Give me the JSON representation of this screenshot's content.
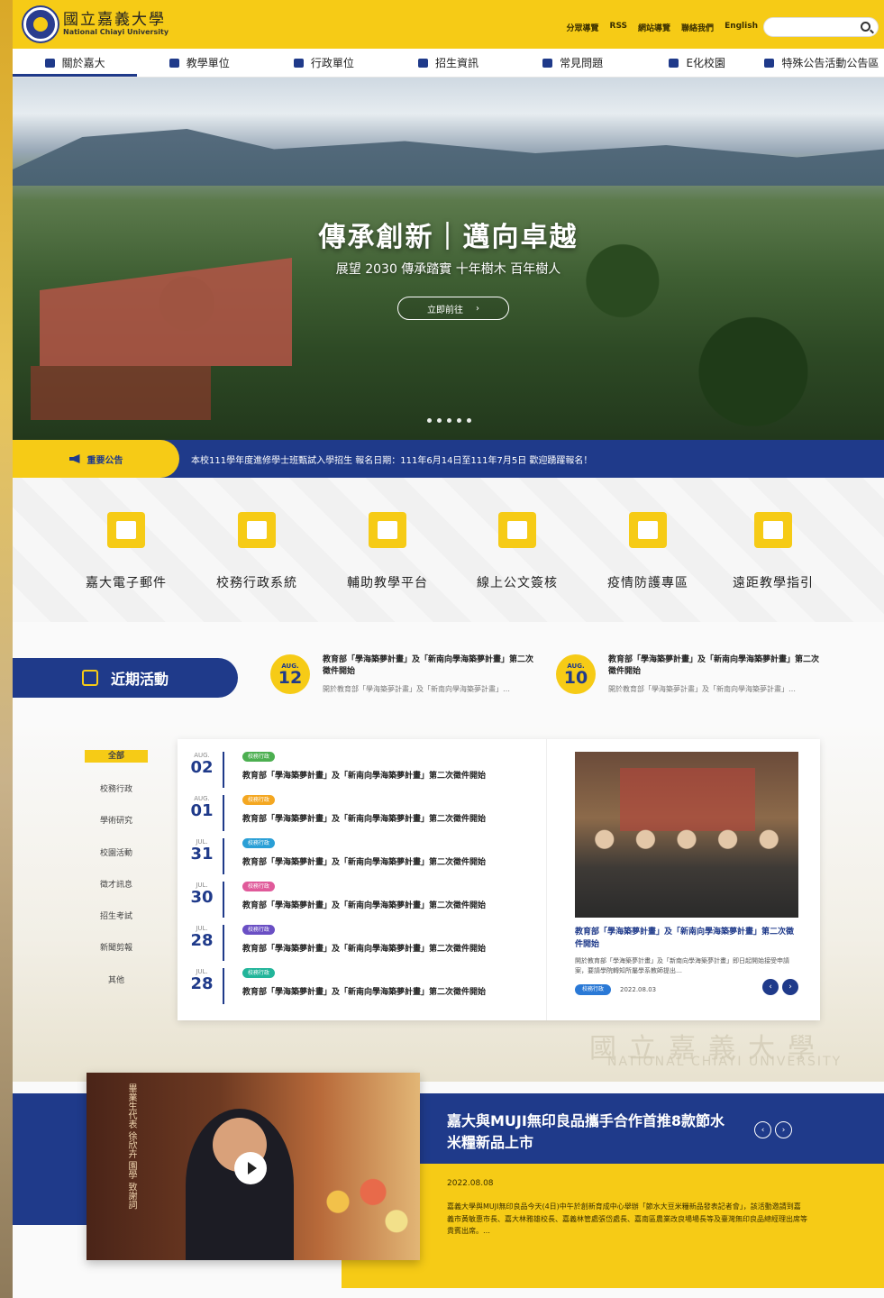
{
  "header": {
    "logo_zh": "國立嘉義大學",
    "logo_en": "National Chiayi University",
    "links": [
      "分眾導覽",
      "RSS",
      "網站導覽",
      "聯絡我們",
      "English"
    ],
    "search_placeholder": ""
  },
  "nav": [
    {
      "label": "關於嘉大",
      "icon": "building-icon"
    },
    {
      "label": "教學單位",
      "icon": "graduation-cap-icon"
    },
    {
      "label": "行政單位",
      "icon": "office-icon"
    },
    {
      "label": "招生資訊",
      "icon": "signpost-icon"
    },
    {
      "label": "常見問題",
      "icon": "question-icon"
    },
    {
      "label": "E化校園",
      "icon": "monitor-icon"
    },
    {
      "label": "特殊公告活動公告區",
      "icon": "notice-board-icon"
    }
  ],
  "hero": {
    "title": "傳承創新｜邁向卓越",
    "subtitle": "展望 2030 傳承踏實 十年樹木 百年樹人",
    "button": "立即前往",
    "button_arrow": "›"
  },
  "announcement": {
    "tag": "重要公告",
    "text": "本校111學年度進修學士班甄試入學招生 報名日期：111年6月14日至111年7月5日 歡迎踴躍報名！"
  },
  "quick_links": [
    {
      "label": "嘉大電子郵件",
      "icon": "mail-icon"
    },
    {
      "label": "校務行政系統",
      "icon": "admin-system-icon"
    },
    {
      "label": "輔助教學平台",
      "icon": "teaching-platform-icon"
    },
    {
      "label": "線上公文簽核",
      "icon": "document-sign-icon"
    },
    {
      "label": "疫情防護專區",
      "icon": "epidemic-icon"
    },
    {
      "label": "遠距教學指引",
      "icon": "remote-teaching-icon"
    }
  ],
  "events": {
    "heading": "近期活動",
    "items": [
      {
        "month": "AUG.",
        "day": "12",
        "title": "教育部「學海築夢計畫」及「新南向學海築夢計畫」第二次徵件開始",
        "desc": "開於教育部「學海築夢計畫」及「新南向學海築夢計畫」…"
      },
      {
        "month": "AUG.",
        "day": "10",
        "title": "教育部「學海築夢計畫」及「新南向學海築夢計畫」第二次徵件開始",
        "desc": "開於教育部「學海築夢計畫」及「新南向學海築夢計畫」…"
      }
    ]
  },
  "news": {
    "categories": [
      "全部",
      "校務行政",
      "學術研究",
      "校園活動",
      "徵才訊息",
      "招生考試",
      "新聞剪報",
      "其他"
    ],
    "rows": [
      {
        "month": "AUG.",
        "day": "02",
        "badge": "校務行政",
        "badge_color": "#4caf50",
        "title": "教育部「學海築夢計畫」及「新南向學海築夢計畫」第二次徵件開始"
      },
      {
        "month": "AUG.",
        "day": "01",
        "badge": "校務行政",
        "badge_color": "#f4a721",
        "title": "教育部「學海築夢計畫」及「新南向學海築夢計畫」第二次徵件開始"
      },
      {
        "month": "JUL.",
        "day": "31",
        "badge": "校務行政",
        "badge_color": "#2a9fd6",
        "title": "教育部「學海築夢計畫」及「新南向學海築夢計畫」第二次徵件開始"
      },
      {
        "month": "JUL.",
        "day": "30",
        "badge": "校務行政",
        "badge_color": "#e05a9a",
        "title": "教育部「學海築夢計畫」及「新南向學海築夢計畫」第二次徵件開始"
      },
      {
        "month": "JUL.",
        "day": "28",
        "badge": "校務行政",
        "badge_color": "#6a4fc4",
        "title": "教育部「學海築夢計畫」及「新南向學海築夢計畫」第二次徵件開始"
      },
      {
        "month": "JUL.",
        "day": "28",
        "badge": "校務行政",
        "badge_color": "#22b59a",
        "title": "教育部「學海築夢計畫」及「新南向學海築夢計畫」第二次徵件開始"
      }
    ],
    "feature": {
      "title": "教育部「學海築夢計畫」及「新南向學海築夢計畫」第二次徵件開始",
      "desc": "開於教育部「學海築夢計畫」及「新南向學海築夢計畫」即日起開始接受申請案，要請學院轉知所屬學系教師提出…",
      "badge": "校務行政",
      "date": "2022.08.03",
      "prev": "‹",
      "next": "›"
    }
  },
  "watermark": {
    "zh": "國立嘉義大學",
    "en": "NATIONAL CHIAYI UNIVERSITY"
  },
  "feature_news": {
    "video_vertical": "畢業生代表 徐欣卉 園學 致謝詞",
    "title": "嘉大與MUJI無印良品攜手合作首推8款節水米糧新品上市",
    "date": "2022.08.08",
    "desc": "嘉義大學與MUJI無印良品今天(4日)中午於創新育成中心舉辦「節水大豆米糧新品發表記者會」，該活動邀請到嘉義市黃敏惠市長、嘉大林雅雄校長、嘉義林管處張岱處長、嘉南區農業改良場場長等及臺灣無印良品總經理出席等貴賓出席。…",
    "prev": "‹",
    "next": "›"
  },
  "colors": {
    "brand_yellow": "#f6cb16",
    "brand_blue": "#1f3a8a"
  }
}
